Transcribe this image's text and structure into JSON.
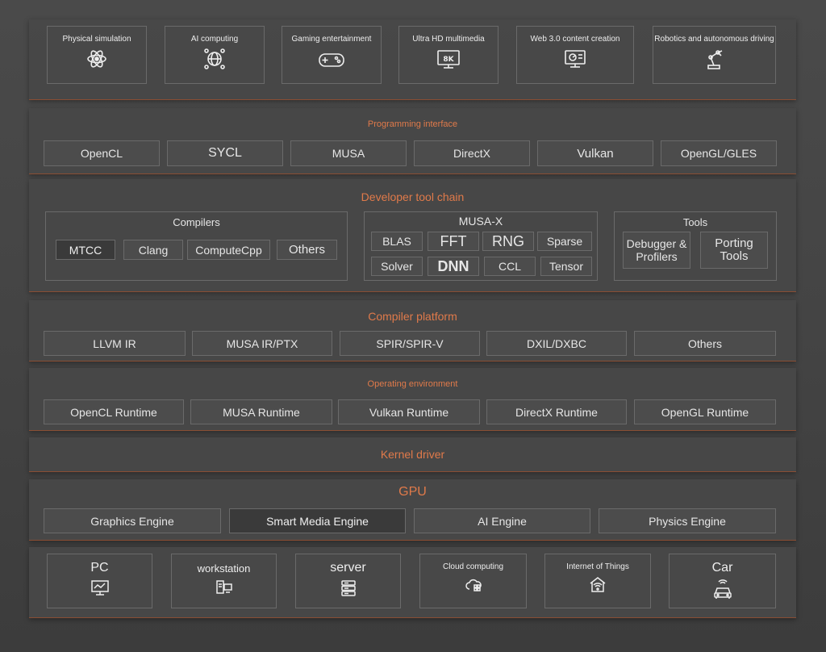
{
  "applications": [
    {
      "label": "Physical simulation",
      "icon": "atom-icon"
    },
    {
      "label": "AI computing",
      "icon": "network-globe-icon"
    },
    {
      "label": "Gaming entertainment",
      "icon": "gamepad-icon"
    },
    {
      "label": "Ultra HD multimedia",
      "icon": "8k-monitor-icon"
    },
    {
      "label": "Web 3.0 content creation",
      "icon": "chart-monitor-icon"
    },
    {
      "label": "Robotics and autonomous driving",
      "icon": "robot-arm-icon"
    }
  ],
  "programming_interface": {
    "title": "Programming interface",
    "items": [
      "OpenCL",
      "SYCL",
      "MUSA",
      "DirectX",
      "Vulkan",
      "OpenGL/GLES"
    ]
  },
  "developer_tool_chain": {
    "title": "Developer tool chain",
    "compilers": {
      "title": "Compilers",
      "items": [
        "MTCC",
        "Clang",
        "ComputeCpp",
        "Others"
      ]
    },
    "musa_x": {
      "title": "MUSA-X",
      "row1": [
        "BLAS",
        "FFT",
        "RNG",
        "Sparse"
      ],
      "row2": [
        "Solver",
        "DNN",
        "CCL",
        "Tensor"
      ]
    },
    "tools": {
      "title": "Tools",
      "items": [
        "Debugger & Profilers",
        "Porting Tools"
      ]
    }
  },
  "compiler_platform": {
    "title": "Compiler platform",
    "items": [
      "LLVM IR",
      "MUSA IR/PTX",
      "SPIR/SPIR-V",
      "DXIL/DXBC",
      "Others"
    ]
  },
  "operating_environment": {
    "title": "Operating environment",
    "items": [
      "OpenCL Runtime",
      "MUSA Runtime",
      "Vulkan Runtime",
      "DirectX Runtime",
      "OpenGL Runtime"
    ]
  },
  "kernel_driver": {
    "title": "Kernel driver"
  },
  "gpu": {
    "title": "GPU",
    "items": [
      "Graphics Engine",
      "Smart Media Engine",
      "AI Engine",
      "Physics Engine"
    ]
  },
  "devices": [
    {
      "label": "PC",
      "icon": "pc-monitor-icon"
    },
    {
      "label": "workstation",
      "icon": "workstation-icon"
    },
    {
      "label": "server",
      "icon": "server-icon"
    },
    {
      "label": "Cloud computing",
      "icon": "cloud-icon"
    },
    {
      "label": "Internet of Things",
      "icon": "iot-home-icon"
    },
    {
      "label": "Car",
      "icon": "car-icon"
    }
  ],
  "colors": {
    "accent": "#e07a4a",
    "border": "#6a6a6a",
    "panel": "#484848"
  }
}
